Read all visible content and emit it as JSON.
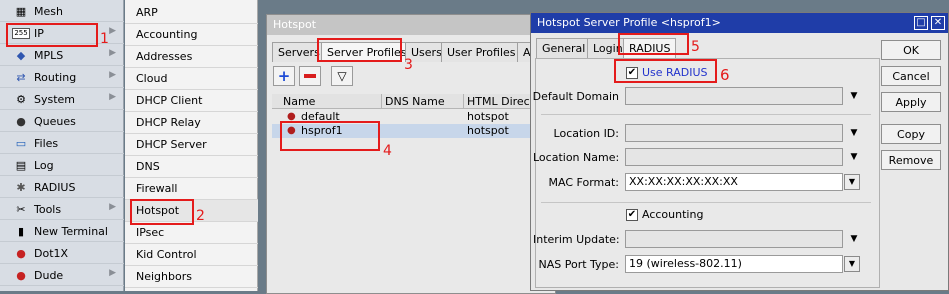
{
  "left_menu": [
    {
      "label": "Mesh",
      "icon": "mesh-icon",
      "glyph": "▦",
      "arrow": false
    },
    {
      "label": "IP",
      "icon": "ip-icon",
      "glyph": "255",
      "arrow": true
    },
    {
      "label": "MPLS",
      "icon": "mpls-icon",
      "glyph": "◆",
      "arrow": true
    },
    {
      "label": "Routing",
      "icon": "routing-icon",
      "glyph": "⇄",
      "arrow": true
    },
    {
      "label": "System",
      "icon": "system-icon",
      "glyph": "⚙",
      "arrow": true
    },
    {
      "label": "Queues",
      "icon": "queues-icon",
      "glyph": "●",
      "arrow": false
    },
    {
      "label": "Files",
      "icon": "files-icon",
      "glyph": "▭",
      "arrow": false
    },
    {
      "label": "Log",
      "icon": "log-icon",
      "glyph": "▤",
      "arrow": false
    },
    {
      "label": "RADIUS",
      "icon": "radius-icon",
      "glyph": "✱",
      "arrow": false
    },
    {
      "label": "Tools",
      "icon": "tools-icon",
      "glyph": "✂",
      "arrow": true
    },
    {
      "label": "New Terminal",
      "icon": "terminal-icon",
      "glyph": "▮",
      "arrow": false
    },
    {
      "label": "Dot1X",
      "icon": "dot1x-icon",
      "glyph": "●",
      "arrow": false
    },
    {
      "label": "Dude",
      "icon": "dude-icon",
      "glyph": "●",
      "arrow": true
    }
  ],
  "ip_submenu": [
    "ARP",
    "Accounting",
    "Addresses",
    "Cloud",
    "DHCP Client",
    "DHCP Relay",
    "DHCP Server",
    "DNS",
    "Firewall",
    "Hotspot",
    "IPsec",
    "Kid Control",
    "Neighbors"
  ],
  "hotspot_window": {
    "title": "Hotspot",
    "tabs": [
      "Servers",
      "Server Profiles",
      "Users",
      "User Profiles",
      "Ac"
    ],
    "columns": [
      "Name",
      "DNS Name",
      "HTML Director"
    ],
    "rows": [
      {
        "name": "default",
        "dns": "",
        "html": "hotspot",
        "selected": false
      },
      {
        "name": "hsprof1",
        "dns": "",
        "html": "hotspot",
        "selected": true
      }
    ]
  },
  "profile_window": {
    "title": "Hotspot Server Profile <hsprof1>",
    "tabs": [
      "General",
      "Login",
      "RADIUS"
    ],
    "use_radius_label": "Use RADIUS",
    "use_radius_checked": true,
    "fields": {
      "default_domain": {
        "label": "Default Domain",
        "value": ""
      },
      "location_id": {
        "label": "Location ID:",
        "value": ""
      },
      "location_name": {
        "label": "Location Name:",
        "value": ""
      },
      "mac_format": {
        "label": "MAC Format:",
        "value": "XX:XX:XX:XX:XX:XX"
      },
      "interim_update": {
        "label": "Interim Update:",
        "value": ""
      },
      "nas_port_type": {
        "label": "NAS Port Type:",
        "value": "19 (wireless-802.11)"
      }
    },
    "accounting_label": "Accounting",
    "accounting_checked": true,
    "buttons": [
      "OK",
      "Cancel",
      "Apply",
      "Copy",
      "Remove"
    ]
  },
  "annotations": [
    "1",
    "2",
    "3",
    "4",
    "5",
    "6"
  ],
  "colors": {
    "annotation": "#e41b1b",
    "active_title": "#1f3da8",
    "selection": "#c7d6ea"
  }
}
